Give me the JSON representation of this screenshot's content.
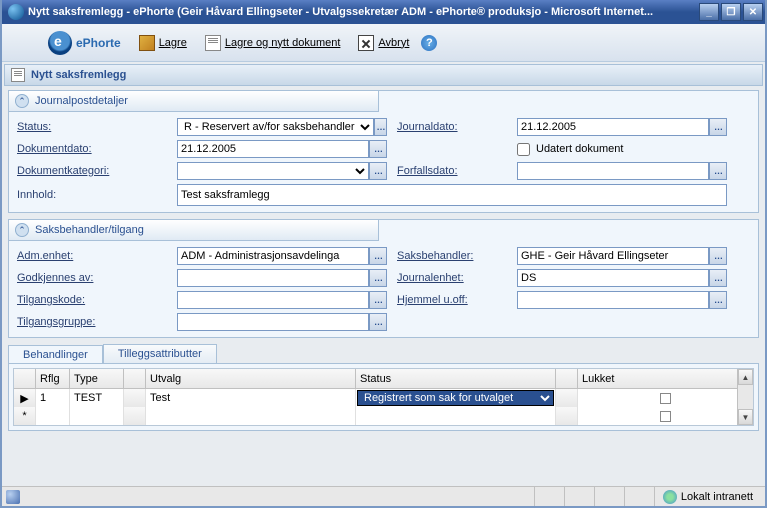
{
  "window": {
    "title": "Nytt saksfremlegg - ePhorte (Geir Håvard Ellingseter - Utvalgssekretær ADM - ePhorte® produksjo - Microsoft Internet..."
  },
  "logo": {
    "text": "ePhorte"
  },
  "toolbar": {
    "save": "Lagre",
    "save_new": "Lagre og nytt dokument",
    "cancel": "Avbryt",
    "help": "?"
  },
  "subtitle": "Nytt saksfremlegg",
  "panel1": {
    "title": "Journalpostdetaljer",
    "status_lbl": "Status:",
    "status_val": "R - Reservert av/for saksbehandler",
    "journaldato_lbl": "Journaldato:",
    "journaldato_val": "21.12.2005",
    "dokdato_lbl": "Dokumentdato:",
    "dokdato_val": "21.12.2005",
    "udatert_lbl": "Udatert dokument",
    "dokkat_lbl": "Dokumentkategori:",
    "dokkat_val": "",
    "forfall_lbl": "Forfallsdato:",
    "forfall_val": "",
    "innhold_lbl": "Innhold:",
    "innhold_val": "Test saksframlegg"
  },
  "panel2": {
    "title": "Saksbehandler/tilgang",
    "admenhet_lbl": "Adm.enhet:",
    "admenhet_val": "ADM - Administrasjonsavdelinga",
    "saksbeh_lbl": "Saksbehandler:",
    "saksbeh_val": "GHE - Geir Håvard Ellingseter",
    "godkjenn_lbl": "Godkjennes av:",
    "godkjenn_val": "",
    "journalenhet_lbl": "Journalenhet:",
    "journalenhet_val": "DS",
    "tilgangskode_lbl": "Tilgangskode:",
    "tilgangskode_val": "",
    "hjemmel_lbl": "Hjemmel u.off:",
    "hjemmel_val": "",
    "tilgangsgruppe_lbl": "Tilgangsgruppe:",
    "tilgangsgruppe_val": ""
  },
  "tabs": {
    "t1": "Behandlinger",
    "t2": "Tilleggsattributter"
  },
  "grid": {
    "h_rflg": "Rflg",
    "h_type": "Type",
    "h_blank": "",
    "h_utvalg": "Utvalg",
    "h_status": "Status",
    "h_lukket": "Lukket",
    "r1_rflg": "1",
    "r1_type": "TEST",
    "r1_utvalg": "Test",
    "r1_status": "Registrert som sak for utvalget",
    "newrow_mark": "*"
  },
  "statusbar": {
    "zone": "Lokalt intranett"
  }
}
